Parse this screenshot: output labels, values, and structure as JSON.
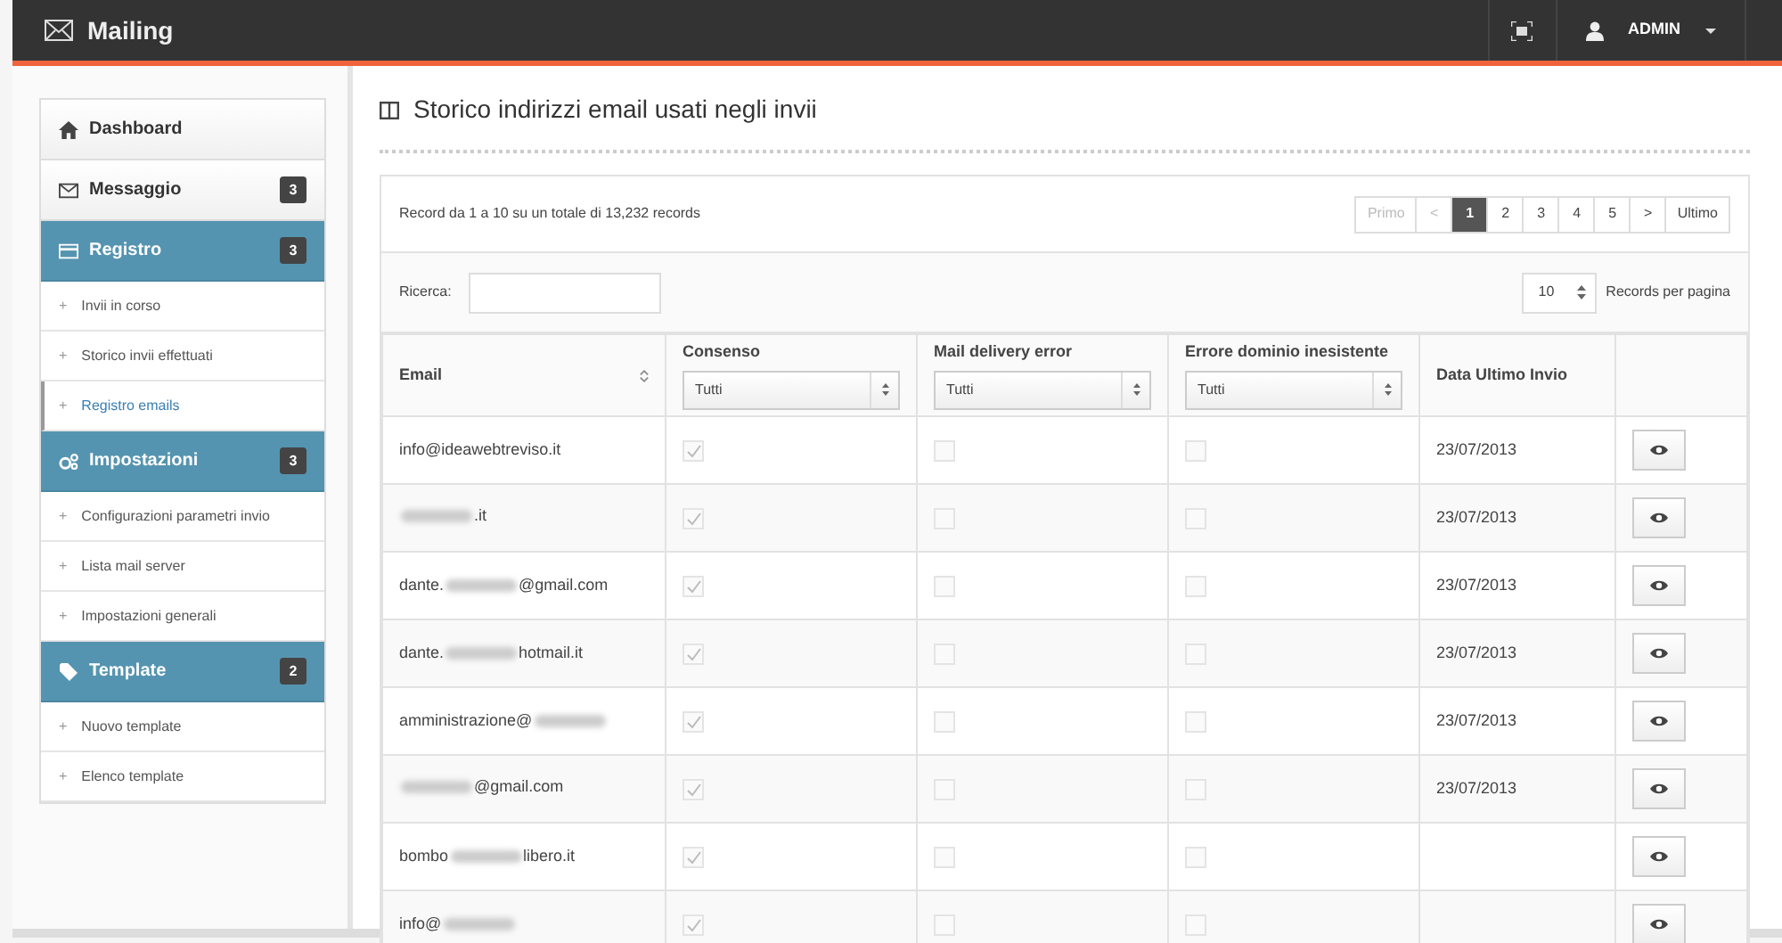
{
  "app": {
    "title": "Mailing",
    "user": "ADMIN"
  },
  "sidebar": {
    "items": [
      {
        "kind": "link",
        "label": "Dashboard"
      },
      {
        "kind": "link",
        "label": "Messaggio",
        "badge": "3"
      },
      {
        "kind": "section",
        "label": "Registro",
        "badge": "3",
        "children": [
          {
            "bullet": "+",
            "label": "Invii in corso",
            "selected": false
          },
          {
            "bullet": "+",
            "label": "Storico invii effettuati",
            "selected": false
          },
          {
            "bullet": "+",
            "label": "Registro emails",
            "selected": true
          }
        ]
      },
      {
        "kind": "section",
        "label": "Impostazioni",
        "badge": "3",
        "children": [
          {
            "bullet": "+",
            "label": "Configurazioni parametri invio",
            "selected": false
          },
          {
            "bullet": "+",
            "label": "Lista mail server",
            "selected": false
          },
          {
            "bullet": "+",
            "label": "Impostazioni generali",
            "selected": false
          }
        ]
      },
      {
        "kind": "section",
        "label": "Template",
        "badge": "2",
        "children": [
          {
            "bullet": "+",
            "label": "Nuovo template",
            "selected": false
          },
          {
            "bullet": "+",
            "label": "Elenco template",
            "selected": false
          }
        ]
      }
    ]
  },
  "page": {
    "title": "Storico indirizzi email usati negli invii",
    "summary": "Record da 1 a 10 su un totale di 13,232 records",
    "pagination": [
      {
        "label": "Primo",
        "selected": false,
        "disabled": true
      },
      {
        "label": "<",
        "selected": false,
        "disabled": true
      },
      {
        "label": "1",
        "selected": true,
        "disabled": false
      },
      {
        "label": "2",
        "selected": false,
        "disabled": false
      },
      {
        "label": "3",
        "selected": false,
        "disabled": false
      },
      {
        "label": "4",
        "selected": false,
        "disabled": false
      },
      {
        "label": "5",
        "selected": false,
        "disabled": false
      },
      {
        "label": ">",
        "selected": false,
        "disabled": false
      },
      {
        "label": "Ultimo",
        "selected": false,
        "disabled": false
      }
    ],
    "search_label": "Ricerca:",
    "page_size": "10",
    "page_size_label": "Records per pagina"
  },
  "table": {
    "columns": [
      {
        "label": "Email"
      },
      {
        "label": "Consenso",
        "filter": "Tutti"
      },
      {
        "label": "Mail delivery error",
        "filter": "Tutti"
      },
      {
        "label": "Errore dominio inesistente",
        "filter": "Tutti"
      },
      {
        "label": "Data Ultimo Invio"
      }
    ],
    "rows": [
      {
        "email_before": "info@ideawebtreviso.it",
        "redacted": false,
        "email_after": "",
        "consent": true,
        "delivery_error": false,
        "domain_error": false,
        "date": "23/07/2013"
      },
      {
        "email_before": "",
        "redacted": true,
        "email_after": ".it",
        "consent": true,
        "delivery_error": false,
        "domain_error": false,
        "date": "23/07/2013"
      },
      {
        "email_before": "dante.",
        "redacted": true,
        "email_after": "@gmail.com",
        "consent": true,
        "delivery_error": false,
        "domain_error": false,
        "date": "23/07/2013"
      },
      {
        "email_before": "dante.",
        "redacted": true,
        "email_after": "hotmail.it",
        "consent": true,
        "delivery_error": false,
        "domain_error": false,
        "date": "23/07/2013"
      },
      {
        "email_before": "amministrazione@",
        "redacted": true,
        "email_after": "",
        "consent": true,
        "delivery_error": false,
        "domain_error": false,
        "date": "23/07/2013"
      },
      {
        "email_before": "",
        "redacted": true,
        "email_after": "@gmail.com",
        "consent": true,
        "delivery_error": false,
        "domain_error": false,
        "date": "23/07/2013"
      },
      {
        "email_before": "bombo",
        "redacted": true,
        "email_after": "libero.it",
        "consent": true,
        "delivery_error": false,
        "domain_error": false,
        "date": ""
      },
      {
        "email_before": "info@",
        "redacted": true,
        "email_after": "",
        "consent": true,
        "delivery_error": false,
        "domain_error": false,
        "date": ""
      }
    ]
  }
}
